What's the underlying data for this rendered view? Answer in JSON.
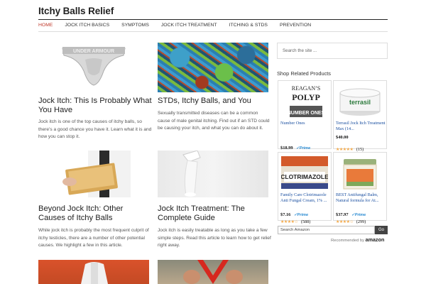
{
  "site": {
    "title": "Itchy Balls Relief"
  },
  "nav": {
    "items": [
      "HOME",
      "JOCK ITCH BASICS",
      "SYMPTOMS",
      "JOCK ITCH TREATMENT",
      "ITCHING & STDS",
      "PREVENTION"
    ]
  },
  "posts": [
    {
      "title": "Jock Itch: This Is Probably What You Have",
      "excerpt": "Jock itch is one of the top causes of itchy balls, so there’s a good chance you have it. Learn what it is and how you can stop it."
    },
    {
      "title": "STDs, Itchy Balls, and You",
      "excerpt": "Sexually transmitted diseases can be a common cause of male genital itching. Find out if an STD could be causing your itch, and what you can do about it."
    },
    {
      "title": "Beyond Jock Itch: Other Causes of Itchy Balls",
      "excerpt": "While jock itch is probably the most frequent culprit of itchy testicles, there are a number of other potential causes. We highlight a few in this article."
    },
    {
      "title": "Jock Itch Treatment: The Complete Guide",
      "excerpt": "Jock itch is easily treatable as long as you take a few simple steps. Read this article to learn how to get relief right away."
    }
  ],
  "sidebar": {
    "search_placeholder": "Search the site ...",
    "heading": "Shop Related Products",
    "products": [
      {
        "name": "Number Ones",
        "price": "$18.99",
        "prime": "✓Prime",
        "img_text_1": "REAGAN’S",
        "img_text_2": "POLYP",
        "img_text_3": "NUMBER ONES"
      },
      {
        "name": "Terrasil Jock Itch Treatment Max (14...",
        "price": "$40.00",
        "reviews": "(15)",
        "stars": "★★★★★",
        "img_text_1": "terrasil"
      },
      {
        "name": "Family Care Clotrimazole Anti Fungal Cream, 1% ...",
        "price": "$7.16",
        "prime": "✓Prime",
        "reviews": "(588)",
        "stars": "★★★★☆",
        "img_text_1": "CLOTRIMAZOLE"
      },
      {
        "name": "BEST Antifungal Balm, Natural formula for At...",
        "price": "$37.97",
        "prime": "✓Prime",
        "reviews": "(299)",
        "stars": "★★★★☆"
      }
    ],
    "amazon_search_placeholder": "Search Amazon",
    "go_label": "Go",
    "recommended_by": "Recommended by",
    "amazon_logo": "amazon"
  },
  "colors": {
    "nav_active": "#c0392b",
    "link": "#1a4fa0",
    "prime": "#2a8bd2",
    "stars": "#f3a847"
  }
}
